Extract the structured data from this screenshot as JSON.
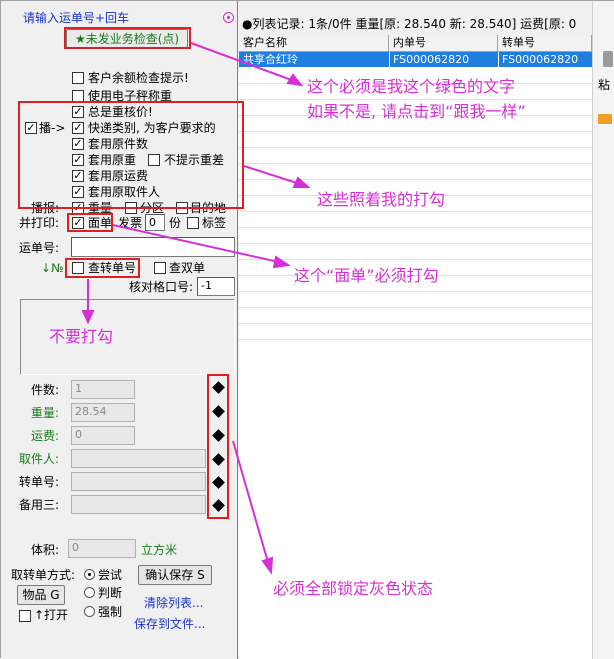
{
  "top": {
    "input_hint": "请输入运单号+回车",
    "status_text": "●列表记录: 1条/0件 重量[原: 28.540 新: 28.540] 运费[原: 0"
  },
  "left": {
    "check_button": "★未发业务检查(点)",
    "options": [
      {
        "label": "客户余额检查提示!",
        "checked": false
      },
      {
        "label": "使用电子秤称重",
        "checked": false
      },
      {
        "label": "总是重核价!",
        "checked": true
      },
      {
        "label": "快递类别, 为客户要求的",
        "checked": true
      },
      {
        "label": "套用原件数",
        "checked": true
      },
      {
        "label": "套用原重",
        "checked": true
      },
      {
        "label": "套用原运费",
        "checked": true
      },
      {
        "label": "套用原取件人",
        "checked": true
      }
    ],
    "no_prompt_heavy": "不提示重差",
    "bo_label": "播->",
    "bo_checked": true,
    "bobao_label": "播报:",
    "bobao_items": [
      {
        "label": "重量",
        "checked": true
      },
      {
        "label": "分区",
        "checked": false
      },
      {
        "label": "目的地",
        "checked": false
      }
    ],
    "print_label": "并打印:",
    "miandan_label": "面单",
    "miandan_checked": true,
    "fapiao_label": "发票",
    "fapiao_value": "0",
    "fen_label": "份",
    "biaoqian_label": "标签",
    "yundan_label": "运单号:",
    "no_arrow": "↓№",
    "zhuan_label": "查转单号",
    "shuang_label": "查双单",
    "hedui_label": "核对格口号:",
    "hedui_value": "-1",
    "fields": [
      {
        "label": "件数:",
        "value": "1",
        "color": "#000000"
      },
      {
        "label": "重量:",
        "value": "28.54",
        "color": "#1a7a1a"
      },
      {
        "label": "运费:",
        "value": "0",
        "color": "#1a7a1a"
      },
      {
        "label": "取件人:",
        "value": "",
        "color": "#1a7a1a"
      },
      {
        "label": "转单号:",
        "value": "",
        "color": "#000000"
      },
      {
        "label": "备用三:",
        "value": "",
        "color": "#000000"
      }
    ],
    "volume_label": "体积:",
    "volume_value": "0",
    "volume_unit": "立方米",
    "method_label": "取转单方式:",
    "method_options": [
      {
        "label": "尝试",
        "selected": true
      },
      {
        "label": "判断",
        "selected": false
      },
      {
        "label": "强制",
        "selected": false
      }
    ],
    "confirm_button": "确认保存 S",
    "goods_button": "物品 G",
    "open_label": "↑打开",
    "clear_link": "清除列表...",
    "save_file_link": "保存到文件..."
  },
  "grid": {
    "columns": [
      "客户名称",
      "内单号",
      "转单号"
    ],
    "rows": [
      [
        "共享合红玲",
        "FS000062820",
        "FS000062820"
      ]
    ]
  },
  "side": {
    "paste_label": "粘"
  },
  "annotations": {
    "note1_line1": "这个必须是我这个绿色的文字",
    "note1_line2": "如果不是, 请点击到“跟我一样”",
    "note2": "这些照着我的打勾",
    "note3": "这个“面单”必须打勾",
    "note4": "不要打勾",
    "note5": "必须全部锁定灰色状态"
  }
}
